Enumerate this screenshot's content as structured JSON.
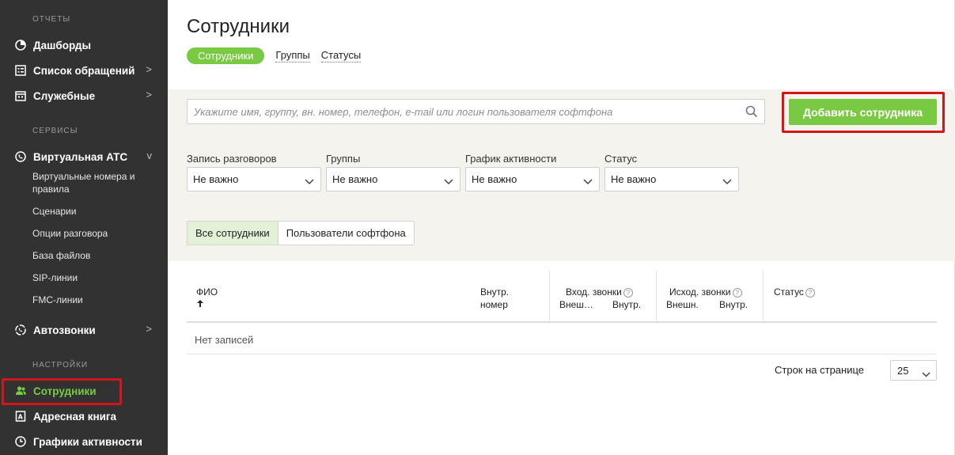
{
  "sidebar": {
    "section_reports": "ОТЧЕТЫ",
    "section_services": "СЕРВИСЫ",
    "section_settings": "НАСТРОЙКИ",
    "dashboards": "Дашборды",
    "requests": "Список обращений",
    "service": "Служебные",
    "vats": "Виртуальная АТС",
    "vats_sub": [
      "Виртуальные номера и правила",
      "Сценарии",
      "Опции разговора",
      "База файлов",
      "SIP-линии",
      "FMC-линии"
    ],
    "autocalls": "Автозвонки",
    "employees": "Сотрудники",
    "address_book": "Адресная книга",
    "activity_schedules": "Графики активности",
    "chevron_right": ">",
    "chevron_down": "v"
  },
  "main": {
    "title": "Сотрудники",
    "tabs": [
      "Сотрудники",
      "Группы",
      "Статусы"
    ],
    "search_placeholder": "Укажите имя, группу, вн. номер, телефон, e-mail или логин пользователя софтфона",
    "add_button": "Добавить сотрудника",
    "filters": [
      {
        "label": "Запись разговоров",
        "value": "Не важно"
      },
      {
        "label": "Группы",
        "value": "Не важно"
      },
      {
        "label": "График активности",
        "value": "Не важно"
      },
      {
        "label": "Статус",
        "value": "Не важно"
      }
    ],
    "segment": [
      "Все сотрудники",
      "Пользователи софтфона"
    ],
    "table": {
      "col_fio": "ФИО",
      "col_ext_1": "Внутр.",
      "col_ext_2": "номер",
      "col_in": "Вход. звонки",
      "col_in_ext": "Внеш…",
      "col_in_int": "Внутр.",
      "col_out": "Исход. звонки",
      "col_out_ext": "Внешн.",
      "col_out_int": "Внутр.",
      "col_status": "Статус",
      "help_glyph": "?",
      "empty": "Нет записей"
    },
    "rows_per_page_label": "Строк на странице",
    "rows_per_page_value": "25"
  },
  "colors": {
    "accent": "#7ac943",
    "sidebar_bg": "#323232",
    "highlight": "#d4161c"
  }
}
